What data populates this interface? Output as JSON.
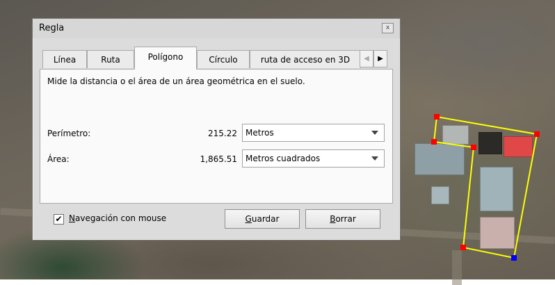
{
  "dialog": {
    "title": "Regla",
    "close_glyph": "x",
    "tabs": [
      {
        "label": "Línea",
        "active": false
      },
      {
        "label": "Ruta",
        "active": false
      },
      {
        "label": "Polígono",
        "active": true
      },
      {
        "label": "Círculo",
        "active": false
      },
      {
        "label": "ruta de acceso en 3D",
        "active": false
      }
    ],
    "tab_scroll_icons": [
      "chevron-left-icon",
      "chevron-right-icon"
    ],
    "description": "Mide la distancia o el área de un área geométrica en el suelo.",
    "perimeter": {
      "label": "Perímetro:",
      "value": "215.22",
      "unit": "Metros"
    },
    "area": {
      "label": "Área:",
      "value": "1,865.51",
      "unit": "Metros cuadrados"
    },
    "mouse_nav": {
      "label_underlined": "N",
      "label_rest": "avegación con mouse",
      "checked": true,
      "check_glyph": "✔"
    },
    "save": {
      "underlined": "G",
      "rest": "uardar"
    },
    "clear": {
      "underlined": "B",
      "rest": "orrar"
    }
  },
  "measurement": {
    "outline_color": "#ffff00",
    "vertex_color": "#ff0000",
    "last_vertex_color": "#0000ff"
  }
}
